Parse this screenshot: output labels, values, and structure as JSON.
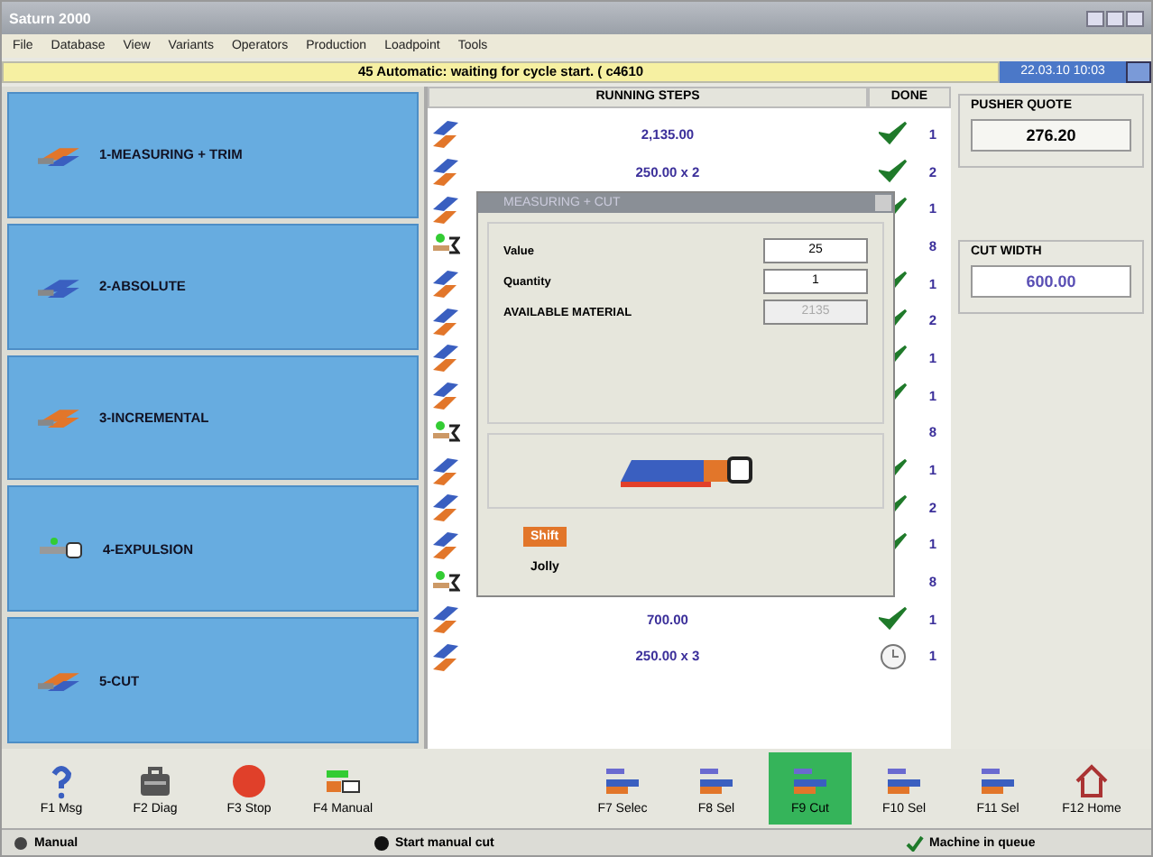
{
  "window": {
    "title": "Saturn 2000"
  },
  "menu": [
    "File",
    "Database",
    "View",
    "Variants",
    "Operators",
    "Production",
    "Loadpoint",
    "Tools"
  ],
  "status_message": "45 Automatic: waiting for cycle start. ( c4610",
  "clock": "22.03.10 10:03",
  "steps_panel": [
    {
      "label": "1-MEASURING + TRIM",
      "kind": "trim"
    },
    {
      "label": "2-ABSOLUTE",
      "kind": "absolute"
    },
    {
      "label": "3-INCREMENTAL",
      "kind": "incremental"
    },
    {
      "label": "4-EXPULSION",
      "kind": "expulsion"
    },
    {
      "label": "5-CUT",
      "kind": "cut"
    }
  ],
  "table": {
    "columns": [
      "RUNNING STEPS",
      "DONE"
    ],
    "rows": [
      {
        "kind": "cut",
        "step": "2,135.00",
        "done": true,
        "count": "1"
      },
      {
        "kind": "cut",
        "step": "250.00 x 2",
        "done": true,
        "count": "2"
      },
      {
        "kind": "cut",
        "done": true,
        "count": "1"
      },
      {
        "kind": "expulsion",
        "count": "8"
      },
      {
        "kind": "cut",
        "done": true,
        "count": "1"
      },
      {
        "kind": "cut",
        "done": true,
        "count": "2"
      },
      {
        "kind": "cut",
        "done": true,
        "count": "1"
      },
      {
        "kind": "cut",
        "done": true,
        "count": "1"
      },
      {
        "kind": "expulsion",
        "count": "8"
      },
      {
        "kind": "cut",
        "done": true,
        "count": "1"
      },
      {
        "kind": "cut",
        "done": true,
        "count": "2"
      },
      {
        "kind": "cut",
        "done": true,
        "count": "1"
      },
      {
        "kind": "expulsion",
        "count": "8"
      },
      {
        "kind": "cut",
        "step": "700.00",
        "done": true,
        "count": "1"
      },
      {
        "kind": "cut",
        "step": "250.00 x 3",
        "done": false,
        "count": "1"
      }
    ]
  },
  "pusher_quote": {
    "label": "PUSHER QUOTE",
    "value": "276.20"
  },
  "cut_width": {
    "label": "CUT WIDTH",
    "value": "600.00"
  },
  "dialog": {
    "title": "MEASURING + CUT",
    "fields": [
      {
        "label": "Value",
        "value": "25",
        "disabled": false
      },
      {
        "label": "Quantity",
        "value": "1",
        "disabled": false
      },
      {
        "label": "AVAILABLE MATERIAL",
        "value": "2135",
        "disabled": true
      }
    ],
    "options": [
      {
        "label": "Shift",
        "selected": true
      },
      {
        "label": "Jolly",
        "selected": false
      }
    ]
  },
  "toolbar": [
    {
      "label": "F1 Msg",
      "kind": "help",
      "selected": false
    },
    {
      "label": "F2 Diag",
      "kind": "case",
      "selected": false
    },
    {
      "label": "F3 Stop",
      "kind": "stop",
      "selected": false
    },
    {
      "label": "F4 Manual",
      "kind": "manual",
      "selected": false
    },
    {
      "kind": "spacer"
    },
    {
      "label": "F7 Selec",
      "kind": "bar",
      "selected": false
    },
    {
      "label": "F8 Sel",
      "kind": "bar",
      "selected": false
    },
    {
      "label": "F9 Cut",
      "kind": "bar",
      "selected": true
    },
    {
      "label": "F10 Sel",
      "kind": "bar",
      "selected": false
    },
    {
      "label": "F11 Sel",
      "kind": "bar",
      "selected": false
    },
    {
      "label": "F12 Home",
      "kind": "home",
      "selected": false
    }
  ],
  "status_bar": [
    {
      "text": "Manual",
      "kind": "mode"
    },
    {
      "text": "Start manual cut",
      "kind": "action"
    },
    {
      "text": "Machine in queue",
      "kind": "ok"
    }
  ]
}
